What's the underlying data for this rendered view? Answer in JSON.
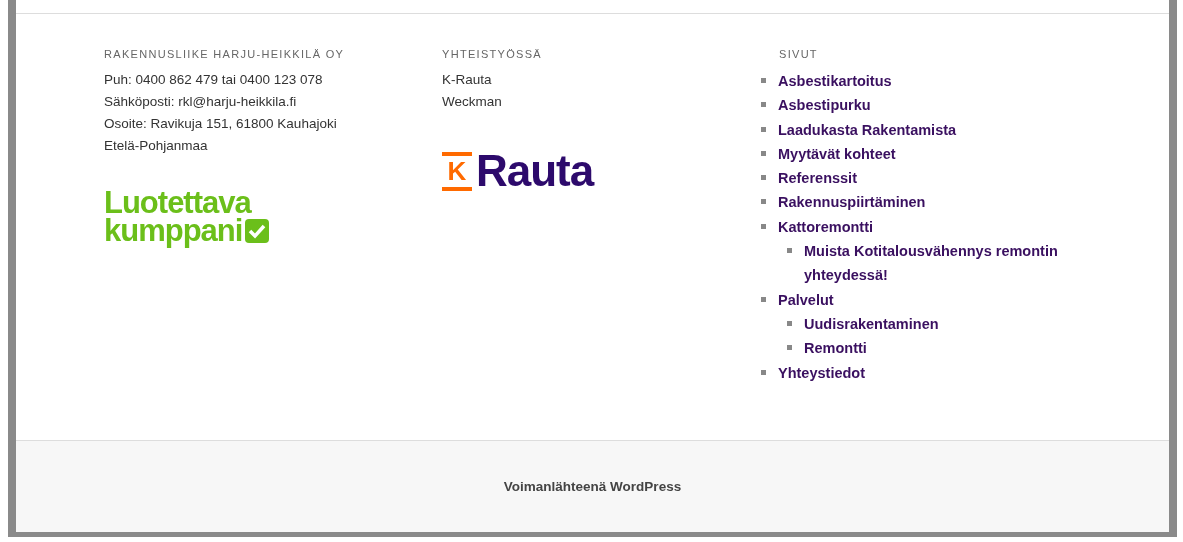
{
  "columns": [
    {
      "heading": "RAKENNUSLIIKE HARJU-HEIKKILÄ OY",
      "lines": [
        "Puh: 0400 862 479 tai 0400 123 078",
        "Sähköposti: rkl@harju-heikkila.fi",
        "Osoite: Ravikuja 151, 61800 Kauhajoki",
        "Etelä-Pohjanmaa"
      ],
      "logo": {
        "kind": "trust",
        "words": [
          "Luotettava",
          "kumppani"
        ]
      }
    },
    {
      "heading": "YHTEISTYÖSSÄ",
      "lines": [
        "K-Rauta",
        "Weckman"
      ],
      "logo": {
        "kind": "krauta",
        "words": [
          "K",
          "Rauta"
        ]
      }
    }
  ],
  "pages": {
    "heading": "SIVUT",
    "items": [
      {
        "label": "Asbestikartoitus"
      },
      {
        "label": "Asbestipurku"
      },
      {
        "label": "Laadukasta Rakentamista"
      },
      {
        "label": "Myytävät kohteet"
      },
      {
        "label": "Referenssit"
      },
      {
        "label": "Rakennuspiirtäminen"
      },
      {
        "label": "Kattoremontti",
        "children": [
          {
            "label": "Muista Kotitalousvähennys remontin yhteydessä!"
          }
        ]
      },
      {
        "label": "Palvelut",
        "children": [
          {
            "label": "Uudisrakentaminen"
          },
          {
            "label": "Remontti"
          }
        ]
      },
      {
        "label": "Yhteystiedot"
      }
    ]
  },
  "footer": {
    "credit": "Voimanlähteenä WordPress"
  }
}
